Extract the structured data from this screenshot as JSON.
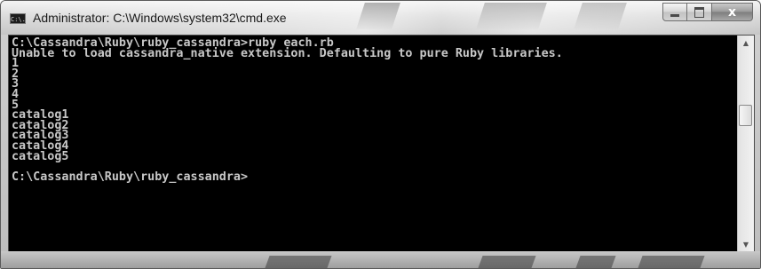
{
  "window": {
    "title": "Administrator: C:\\Windows\\system32\\cmd.exe",
    "icon": "cmd-icon",
    "icon_text": "C:\\."
  },
  "caption_buttons": {
    "minimize": "minimize-icon",
    "maximize": "maximize-icon",
    "close_glyph": "x"
  },
  "console": {
    "background": "#000000",
    "foreground": "#c8c8c8",
    "lines": [
      "C:\\Cassandra\\Ruby\\ruby_cassandra>ruby each.rb",
      "Unable to load cassandra_native extension. Defaulting to pure Ruby libraries.",
      "1",
      "2",
      "3",
      "4",
      "5",
      "catalog1",
      "catalog2",
      "catalog3",
      "catalog4",
      "catalog5",
      "",
      "C:\\Cassandra\\Ruby\\ruby_cassandra>"
    ]
  },
  "scrollbar": {
    "up_icon": "scroll-up-arrow-icon",
    "down_icon": "scroll-down-arrow-icon"
  }
}
